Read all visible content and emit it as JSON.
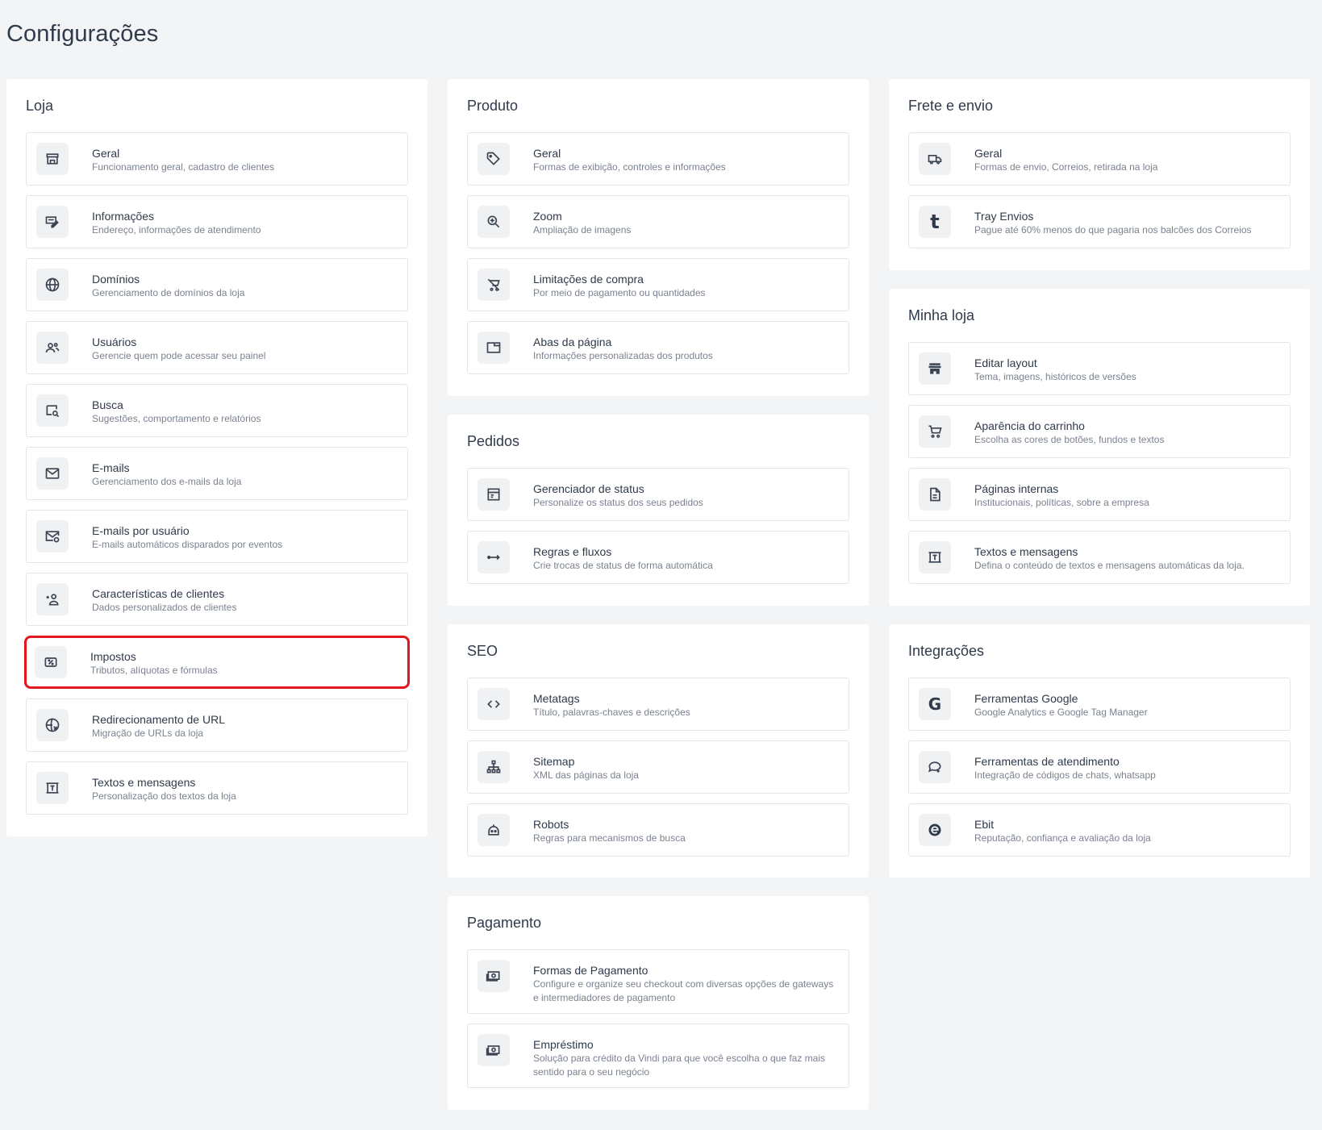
{
  "page": {
    "title": "Configurações"
  },
  "sections": {
    "loja": {
      "title": "Loja",
      "items": [
        {
          "title": "Geral",
          "desc": "Funcionamento geral, cadastro de clientes",
          "icon": "storefront-icon"
        },
        {
          "title": "Informações",
          "desc": "Endereço, informações de atendimento",
          "icon": "edit-card-icon"
        },
        {
          "title": "Domínios",
          "desc": "Gerenciamento de domínios da loja",
          "icon": "globe-icon"
        },
        {
          "title": "Usuários",
          "desc": "Gerencie quem pode acessar seu painel",
          "icon": "users-icon"
        },
        {
          "title": "Busca",
          "desc": "Sugestões, comportamento e relatórios",
          "icon": "search-list-icon"
        },
        {
          "title": "E-mails",
          "desc": "Gerenciamento dos e-mails da loja",
          "icon": "mail-icon"
        },
        {
          "title": "E-mails por usuário",
          "desc": "E-mails automáticos disparados por eventos",
          "icon": "mail-clock-icon"
        },
        {
          "title": "Características de clientes",
          "desc": "Dados personalizados de clientes",
          "icon": "user-sparkle-icon"
        },
        {
          "title": "Impostos",
          "desc": "Tributos, alíquotas e fórmulas",
          "icon": "tax-icon"
        },
        {
          "title": "Redirecionamento de URL",
          "desc": "Migração de URLs da loja",
          "icon": "globe-redirect-icon"
        },
        {
          "title": "Textos e mensagens",
          "desc": "Personalização dos textos da loja",
          "icon": "text-frame-icon"
        }
      ]
    },
    "produto": {
      "title": "Produto",
      "items": [
        {
          "title": "Geral",
          "desc": "Formas de exibição, controles e informações",
          "icon": "tag-icon"
        },
        {
          "title": "Zoom",
          "desc": "Ampliação de imagens",
          "icon": "zoom-in-icon"
        },
        {
          "title": "Limitações de compra",
          "desc": "Por meio de pagamento ou quantidades",
          "icon": "cart-off-icon"
        },
        {
          "title": "Abas da página",
          "desc": "Informações personalizadas dos produtos",
          "icon": "tab-window-icon"
        }
      ]
    },
    "pedidos": {
      "title": "Pedidos",
      "items": [
        {
          "title": "Gerenciador de status",
          "desc": "Personalize os status dos seus pedidos",
          "icon": "status-list-icon"
        },
        {
          "title": "Regras e fluxos",
          "desc": "Crie trocas de status de forma automática",
          "icon": "flow-arrows-icon"
        }
      ]
    },
    "seo": {
      "title": "SEO",
      "items": [
        {
          "title": "Metatags",
          "desc": "Título, palavras-chaves e descrições",
          "icon": "code-icon"
        },
        {
          "title": "Sitemap",
          "desc": "XML das páginas da loja",
          "icon": "sitemap-icon"
        },
        {
          "title": "Robots",
          "desc": "Regras para mecanismos de busca",
          "icon": "robot-icon"
        }
      ]
    },
    "pagamento": {
      "title": "Pagamento",
      "items": [
        {
          "title": "Formas de Pagamento",
          "desc": "Configure e organize seu checkout com diversas opções de gateways e intermediadores de pagamento",
          "icon": "money-icon"
        },
        {
          "title": "Empréstimo",
          "desc": "Solução para crédito da Vindi para que você escolha o que faz mais sentido para o seu negócio",
          "icon": "money-icon"
        }
      ]
    },
    "frete": {
      "title": "Frete e envio",
      "items": [
        {
          "title": "Geral",
          "desc": "Formas de envio, Correios, retirada na loja",
          "icon": "truck-icon"
        },
        {
          "title": "Tray Envios",
          "desc": "Pague até 60% menos do que pagaria nos balcões dos Correios",
          "icon": "tray-logo-icon",
          "glyph": "t"
        }
      ]
    },
    "minhaloja": {
      "title": "Minha loja",
      "items": [
        {
          "title": "Editar layout",
          "desc": "Tema, imagens, históricos de versões",
          "icon": "store-layout-icon"
        },
        {
          "title": "Aparência do carrinho",
          "desc": "Escolha as cores de botões, fundos e textos",
          "icon": "cart-icon"
        },
        {
          "title": "Páginas internas",
          "desc": "Institucionais, políticas, sobre a empresa",
          "icon": "document-icon"
        },
        {
          "title": "Textos e mensagens",
          "desc": "Defina o conteúdo de textos e mensagens automáticas da loja.",
          "icon": "text-frame-icon"
        }
      ]
    },
    "integracoes": {
      "title": "Integrações",
      "items": [
        {
          "title": "Ferramentas Google",
          "desc": "Google Analytics e Google Tag Manager",
          "icon": "google-icon",
          "glyph": "G"
        },
        {
          "title": "Ferramentas de atendimento",
          "desc": "Integração de códigos de chats, whatsapp",
          "icon": "chat-icon"
        },
        {
          "title": "Ebit",
          "desc": "Reputação, confiança e avaliação da loja",
          "icon": "ebit-logo-icon"
        }
      ]
    }
  },
  "colors": {
    "highlight": "#e0171c",
    "background": "#f3f4f6",
    "panel": "#ffffff"
  }
}
